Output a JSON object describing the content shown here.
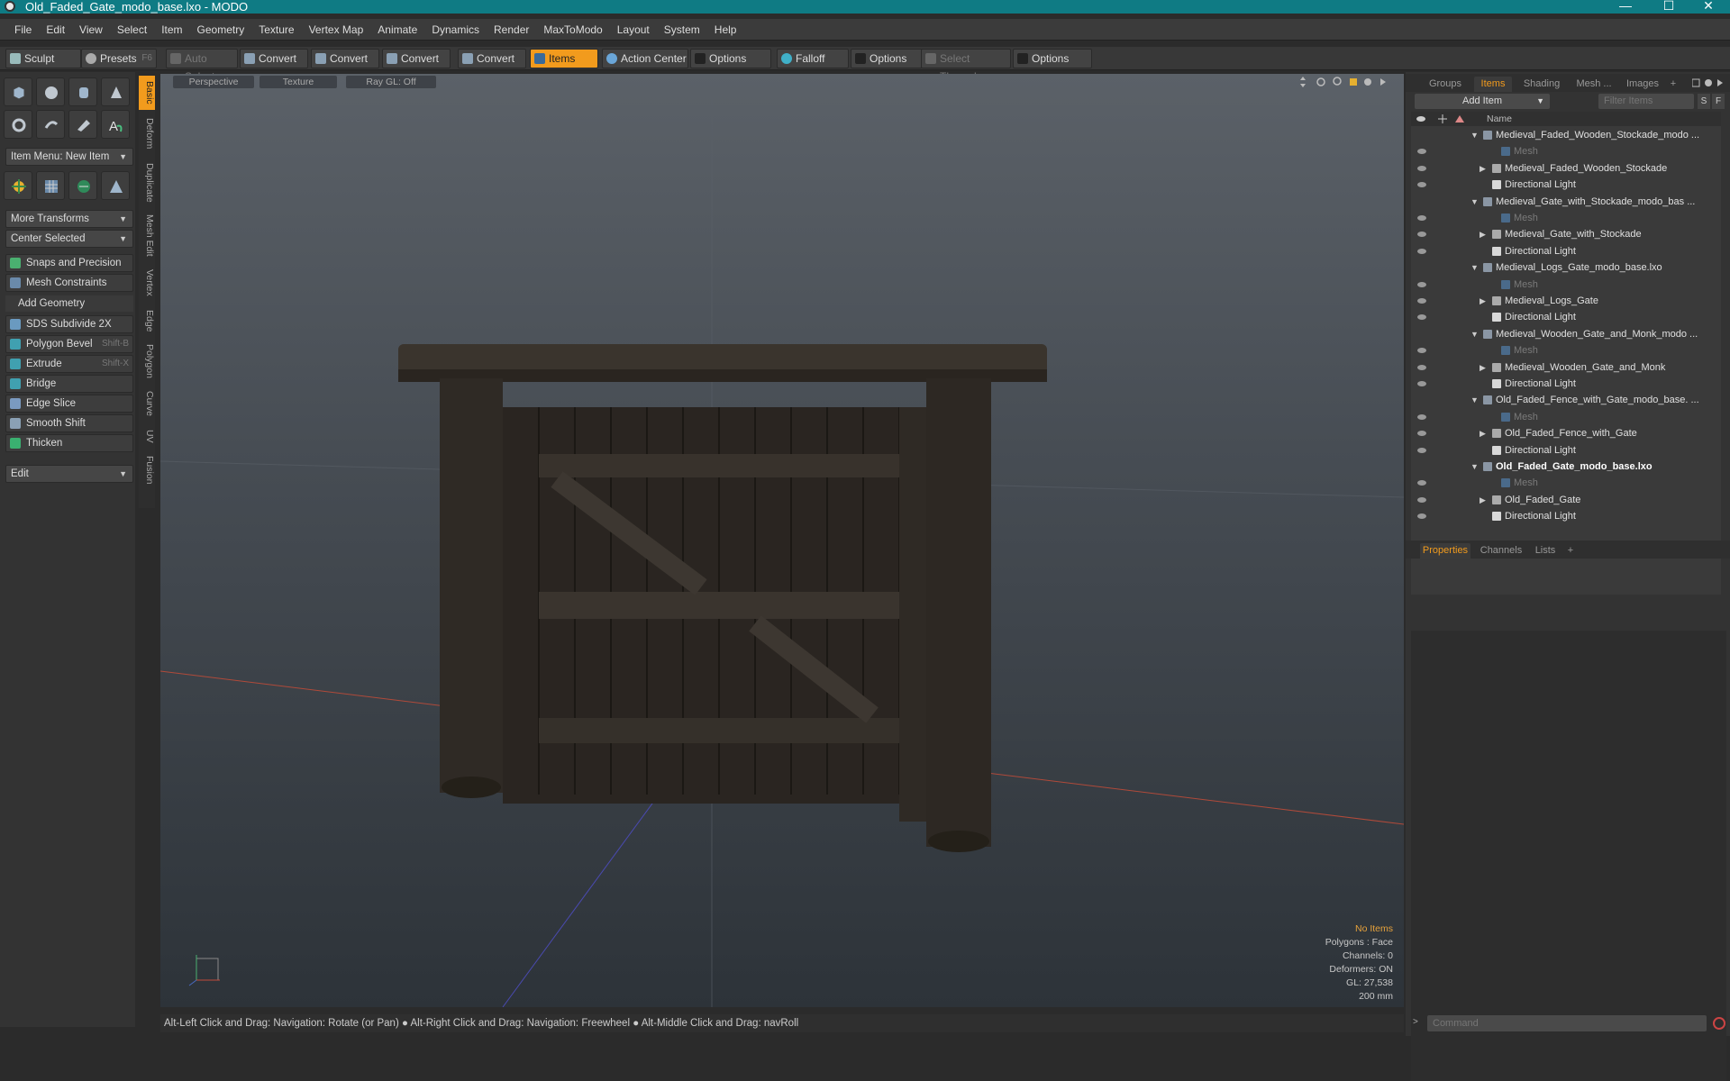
{
  "window": {
    "title": "Old_Faded_Gate_modo_base.lxo - MODO",
    "controls": [
      "—",
      "☐",
      "✕"
    ]
  },
  "menu": [
    "File",
    "Edit",
    "View",
    "Select",
    "Item",
    "Geometry",
    "Texture",
    "Vertex Map",
    "Animate",
    "Dynamics",
    "Render",
    "MaxToModo",
    "Layout",
    "System",
    "Help"
  ],
  "toolbar": {
    "sculpt": "Sculpt",
    "presets": "Presets",
    "presets_shortcut": "F6",
    "auto_select": "Auto Select",
    "convert1": "Convert",
    "convert2": "Convert",
    "convert3": "Convert",
    "convert4": "Convert",
    "items": "Items",
    "action_center": "Action Center",
    "options1": "Options",
    "falloff": "Falloff",
    "options2": "Options",
    "select_through": "Select Through",
    "options3": "Options"
  },
  "left_panel": {
    "item_menu": "Item Menu: New Item",
    "more_transforms": "More Transforms",
    "center_selected": "Center Selected",
    "snaps": "Snaps and Precision",
    "mesh_constraints": "Mesh Constraints",
    "add_geometry": "Add Geometry",
    "tools": [
      {
        "label": "SDS Subdivide 2X",
        "shortcut": ""
      },
      {
        "label": "Polygon Bevel",
        "shortcut": "Shift-B"
      },
      {
        "label": "Extrude",
        "shortcut": "Shift-X"
      },
      {
        "label": "Bridge",
        "shortcut": ""
      },
      {
        "label": "Edge Slice",
        "shortcut": ""
      },
      {
        "label": "Smooth Shift",
        "shortcut": ""
      },
      {
        "label": "Thicken",
        "shortcut": ""
      }
    ],
    "edit": "Edit",
    "vtabs": [
      "Basic",
      "Deform",
      "Duplicate",
      "Mesh Edit",
      "Vertex",
      "Edge",
      "Polygon",
      "Curve",
      "UV",
      "Fusion"
    ]
  },
  "viewport": {
    "tabs": [
      "Perspective",
      "Texture",
      "Ray GL: Off"
    ],
    "info": [
      "No Items",
      "Polygons : Face",
      "Channels: 0",
      "Deformers: ON",
      "GL: 27,538",
      "200 mm"
    ]
  },
  "status": "Alt-Left Click and Drag: Navigation: Rotate (or Pan) ● Alt-Right Click and Drag: Navigation: Freewheel ● Alt-Middle Click and Drag: navRoll",
  "right_panel": {
    "tabs": [
      "Groups",
      "Items",
      "Shading",
      "Mesh ...",
      "Images",
      "+"
    ],
    "add_item": "Add Item",
    "filter_placeholder": "Filter Items",
    "s": "S",
    "f": "F",
    "name_header": "Name",
    "rows": [
      {
        "label": "Medieval_Faded_Wooden_Stockade_modo ...",
        "level": 0,
        "kind": "scene",
        "expand": "▼",
        "style": ""
      },
      {
        "label": "Mesh",
        "level": 2,
        "kind": "mesh",
        "expand": "",
        "style": "dim"
      },
      {
        "label": "Medieval_Faded_Wooden_Stockade",
        "level": 1,
        "kind": "group",
        "expand": "▶",
        "style": ""
      },
      {
        "label": "Directional Light",
        "level": 1,
        "kind": "light",
        "expand": "",
        "style": ""
      },
      {
        "label": "Medieval_Gate_with_Stockade_modo_bas ...",
        "level": 0,
        "kind": "scene",
        "expand": "▼",
        "style": ""
      },
      {
        "label": "Mesh",
        "level": 2,
        "kind": "mesh",
        "expand": "",
        "style": "dim"
      },
      {
        "label": "Medieval_Gate_with_Stockade",
        "level": 1,
        "kind": "group",
        "expand": "▶",
        "style": ""
      },
      {
        "label": "Directional Light",
        "level": 1,
        "kind": "light",
        "expand": "",
        "style": ""
      },
      {
        "label": "Medieval_Logs_Gate_modo_base.lxo",
        "level": 0,
        "kind": "scene",
        "expand": "▼",
        "style": ""
      },
      {
        "label": "Mesh",
        "level": 2,
        "kind": "mesh",
        "expand": "",
        "style": "dim"
      },
      {
        "label": "Medieval_Logs_Gate",
        "level": 1,
        "kind": "group",
        "expand": "▶",
        "style": ""
      },
      {
        "label": "Directional Light",
        "level": 1,
        "kind": "light",
        "expand": "",
        "style": ""
      },
      {
        "label": "Medieval_Wooden_Gate_and_Monk_modo ...",
        "level": 0,
        "kind": "scene",
        "expand": "▼",
        "style": ""
      },
      {
        "label": "Mesh",
        "level": 2,
        "kind": "mesh",
        "expand": "",
        "style": "dim"
      },
      {
        "label": "Medieval_Wooden_Gate_and_Monk",
        "level": 1,
        "kind": "group",
        "expand": "▶",
        "style": ""
      },
      {
        "label": "Directional Light",
        "level": 1,
        "kind": "light",
        "expand": "",
        "style": ""
      },
      {
        "label": "Old_Faded_Fence_with_Gate_modo_base. ...",
        "level": 0,
        "kind": "scene",
        "expand": "▼",
        "style": ""
      },
      {
        "label": "Mesh",
        "level": 2,
        "kind": "mesh",
        "expand": "",
        "style": "dim"
      },
      {
        "label": "Old_Faded_Fence_with_Gate",
        "level": 1,
        "kind": "group",
        "expand": "▶",
        "style": ""
      },
      {
        "label": "Directional Light",
        "level": 1,
        "kind": "light",
        "expand": "",
        "style": ""
      },
      {
        "label": "Old_Faded_Gate_modo_base.lxo",
        "level": 0,
        "kind": "scene",
        "expand": "▼",
        "style": "bold"
      },
      {
        "label": "Mesh",
        "level": 2,
        "kind": "mesh",
        "expand": "",
        "style": "dim"
      },
      {
        "label": "Old_Faded_Gate",
        "level": 1,
        "kind": "group",
        "expand": "▶",
        "style": ""
      },
      {
        "label": "Directional Light",
        "level": 1,
        "kind": "light",
        "expand": "",
        "style": ""
      }
    ],
    "props_tabs": [
      "Properties",
      "Channels",
      "Lists",
      "+"
    ],
    "command_placeholder": "Command"
  },
  "colors": {
    "accent": "#f29b1d",
    "titlebar": "#0f7b84"
  }
}
